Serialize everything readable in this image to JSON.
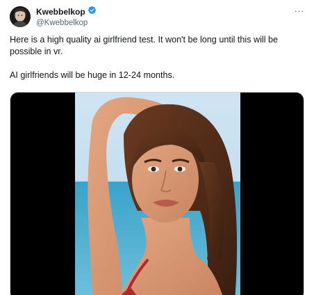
{
  "author": {
    "display_name": "Kwebbelkop",
    "handle": "@Kwebbelkop",
    "verified": true,
    "avatar_icon": "avatar-photo-icon"
  },
  "menu": {
    "more_label": "···"
  },
  "tweet": {
    "line1": "Here is a high quality ai girlfriend test. It won't be long until this will be possible in vr.",
    "line2": "AI girlfriends will be huge in 12-24 months."
  },
  "media": {
    "icon": "photo-icon"
  },
  "colors": {
    "verified_badge": "#1d9bf0",
    "handle": "#536471",
    "text": "#0f1419"
  }
}
